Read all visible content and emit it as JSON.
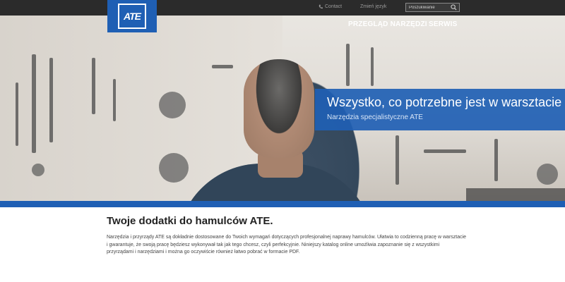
{
  "header": {
    "logo_text": "ATE",
    "contact_label": "Contact",
    "language_label": "Zmień język",
    "search_placeholder": "Poszukiwanie"
  },
  "nav": {
    "items": [
      {
        "label": "PRZEGLĄD NARZĘDZI"
      },
      {
        "label": "SERWIS"
      }
    ]
  },
  "hero": {
    "title": "Wszystko, co potrzebne jest w warsztacie",
    "subtitle": "Narzędzia specjalistyczne ATE"
  },
  "content": {
    "title": "Twoje dodatki do hamulców ATE.",
    "body": "Narzędzia i przyrządy ATE są dokładnie dostosowane do Twoich wymagań dotyczących profesjonalnej naprawy hamulców. Ułatwia to codzienną pracę w warsztacie i gwarantuje, że swoją pracę będziesz wykonywał tak jak tego chcesz, czyli perfekcyjnie. Niniejszy katalog online umożliwia zapoznanie się z wszystkimi przyrządami i narzędziami i można go oczywiście również łatwo pobrać w formacie PDF."
  },
  "colors": {
    "brand_blue": "#1f5fb4",
    "topbar": "#2b2b2b"
  }
}
